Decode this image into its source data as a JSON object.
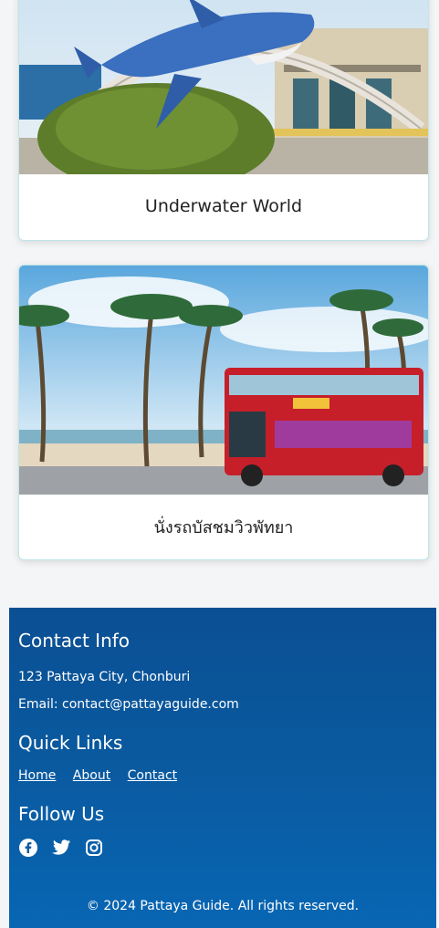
{
  "cards": [
    {
      "title": "Underwater World"
    },
    {
      "title": "นั่งรถบัสชมวิวพัทยา"
    }
  ],
  "footer": {
    "contact_heading": "Contact Info",
    "address": "123 Pattaya City, Chonburi",
    "email": "Email: contact@pattayaguide.com",
    "links_heading": "Quick Links",
    "links": [
      "Home",
      "About",
      "Contact"
    ],
    "follow_heading": "Follow Us",
    "social_icons": [
      "facebook-icon",
      "twitter-icon",
      "instagram-icon"
    ],
    "copyright": "© 2024 Pattaya Guide. All rights reserved."
  },
  "colors": {
    "footer_bg": "#0b5aa0",
    "card_border": "#bfe6ea"
  }
}
